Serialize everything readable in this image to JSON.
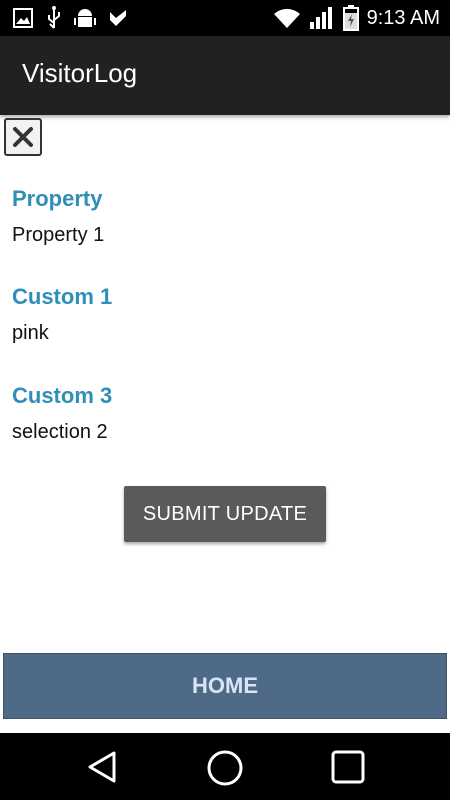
{
  "status_bar": {
    "time": "9:13 AM",
    "left_icons": [
      "image-icon",
      "usb-icon",
      "android-debug-icon",
      "check-icon"
    ],
    "right_icons": [
      "wifi-icon",
      "signal-icon",
      "battery-charging-icon"
    ]
  },
  "app_bar": {
    "title": "VisitorLog"
  },
  "fields": [
    {
      "label": "Property",
      "value": "Property 1"
    },
    {
      "label": "Custom 1",
      "value": "pink"
    },
    {
      "label": "Custom 3",
      "value": "selection 2"
    }
  ],
  "actions": {
    "submit_label": "SUBMIT UPDATE",
    "home_label": "HOME"
  },
  "nav_bar": {
    "icons": [
      "back-icon",
      "home-circle-icon",
      "recents-icon"
    ]
  },
  "colors": {
    "label_accent": "#2f8fb8",
    "app_bar": "#212121",
    "home_button": "#4e6a86",
    "submit_button": "#5a5a5a"
  }
}
